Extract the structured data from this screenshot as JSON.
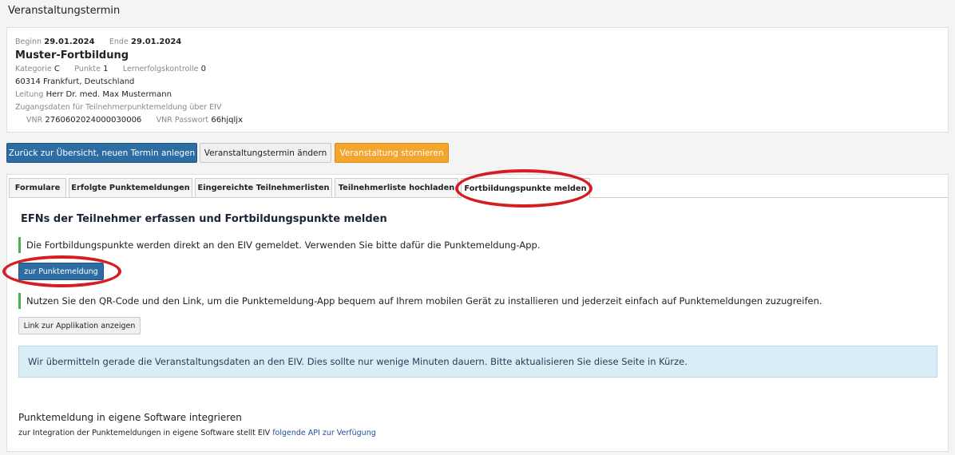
{
  "page": {
    "title": "Veranstaltungstermin"
  },
  "event": {
    "begin_label": "Beginn",
    "begin_value": "29.01.2024",
    "end_label": "Ende",
    "end_value": "29.01.2024",
    "name": "Muster-Fortbildung",
    "category_label": "Kategorie",
    "category_value": "C",
    "points_label": "Punkte",
    "points_value": "1",
    "assessment_label": "Lernerfolgskontrolle",
    "assessment_value": "0",
    "location": "60314 Frankfurt, Deutschland",
    "lead_label": "Leitung",
    "lead_value": "Herr Dr. med. Max Mustermann",
    "access_heading": "Zugangsdaten für Teilnehmerpunktemeldung über EIV",
    "vnr_label": "VNR",
    "vnr_value": "2760602024000030006",
    "vnr_pw_label": "VNR Passwort",
    "vnr_pw_value": "66hjqljx"
  },
  "actions": {
    "back": "Zurück zur Übersicht, neuen Termin anlegen",
    "edit": "Veranstaltungstermin ändern",
    "cancel": "Veranstaltung stornieren"
  },
  "tabs": [
    {
      "label": "Formulare"
    },
    {
      "label": "Erfolgte Punktemeldungen"
    },
    {
      "label": "Eingereichte Teilnehmerlisten"
    },
    {
      "label": "Teilnehmerliste hochladen"
    },
    {
      "label": "Fortbildungspunkte melden"
    }
  ],
  "content": {
    "heading": "EFNs der Teilnehmer erfassen und Fortbildungspunkte melden",
    "note1": "Die Fortbildungspunkte werden direkt an den EIV gemeldet. Verwenden Sie bitte dafür die Punktemeldung-App.",
    "report_button": "zur Punktemeldung",
    "note2": "Nutzen Sie den QR-Code und den Link, um die Punktemeldung-App bequem auf Ihrem mobilen Gerät zu installieren und jederzeit einfach auf Punktemeldungen zuzugreifen.",
    "link_button": "Link zur Applikation anzeigen",
    "alert": "Wir übermitteln gerade die Veranstaltungsdaten an den EIV. Dies sollte nur wenige Minuten dauern. Bitte aktualisieren Sie diese Seite in Kürze.",
    "integration_heading": "Punktemeldung in eigene Software integrieren",
    "integration_text": "zur Integration der Punktemeldungen in eigene Software stellt EIV",
    "integration_link": "folgende API zur Verfügung"
  },
  "colors": {
    "primary": "#2e6da4",
    "warning": "#f3a52e",
    "alert_bg": "#d9edf7",
    "note_border": "#4caf50",
    "highlight": "#d41e24"
  }
}
